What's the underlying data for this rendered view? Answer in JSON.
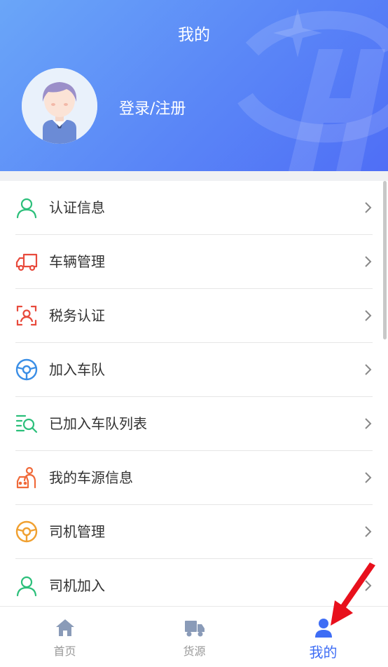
{
  "header": {
    "title": "我的",
    "login_label": "登录/注册"
  },
  "menu": {
    "items": [
      {
        "label": "认证信息",
        "icon": "user-outline-icon",
        "color": "#2bbf7a"
      },
      {
        "label": "车辆管理",
        "icon": "truck-icon",
        "color": "#e84a3c"
      },
      {
        "label": "税务认证",
        "icon": "face-scan-icon",
        "color": "#e84a3c"
      },
      {
        "label": "加入车队",
        "icon": "steering-wheel-icon",
        "color": "#3a8ee6"
      },
      {
        "label": "已加入车队列表",
        "icon": "list-search-icon",
        "color": "#2bbf7a"
      },
      {
        "label": "我的车源信息",
        "icon": "driver-car-icon",
        "color": "#f06a3a"
      },
      {
        "label": "司机管理",
        "icon": "steering-wheel-icon",
        "color": "#f0a030"
      },
      {
        "label": "司机加入",
        "icon": "user-outline-icon",
        "color": "#2bbf7a"
      }
    ]
  },
  "tabbar": {
    "tabs": [
      {
        "label": "首页",
        "icon": "home-icon"
      },
      {
        "label": "货源",
        "icon": "truck-icon"
      },
      {
        "label": "我的",
        "icon": "user-icon",
        "active": true
      }
    ]
  },
  "colors": {
    "header_gradient_start": "#6aa6f8",
    "header_gradient_end": "#4f6ef6",
    "active_tab": "#3e6df5",
    "annotation_arrow": "#e8101c"
  }
}
